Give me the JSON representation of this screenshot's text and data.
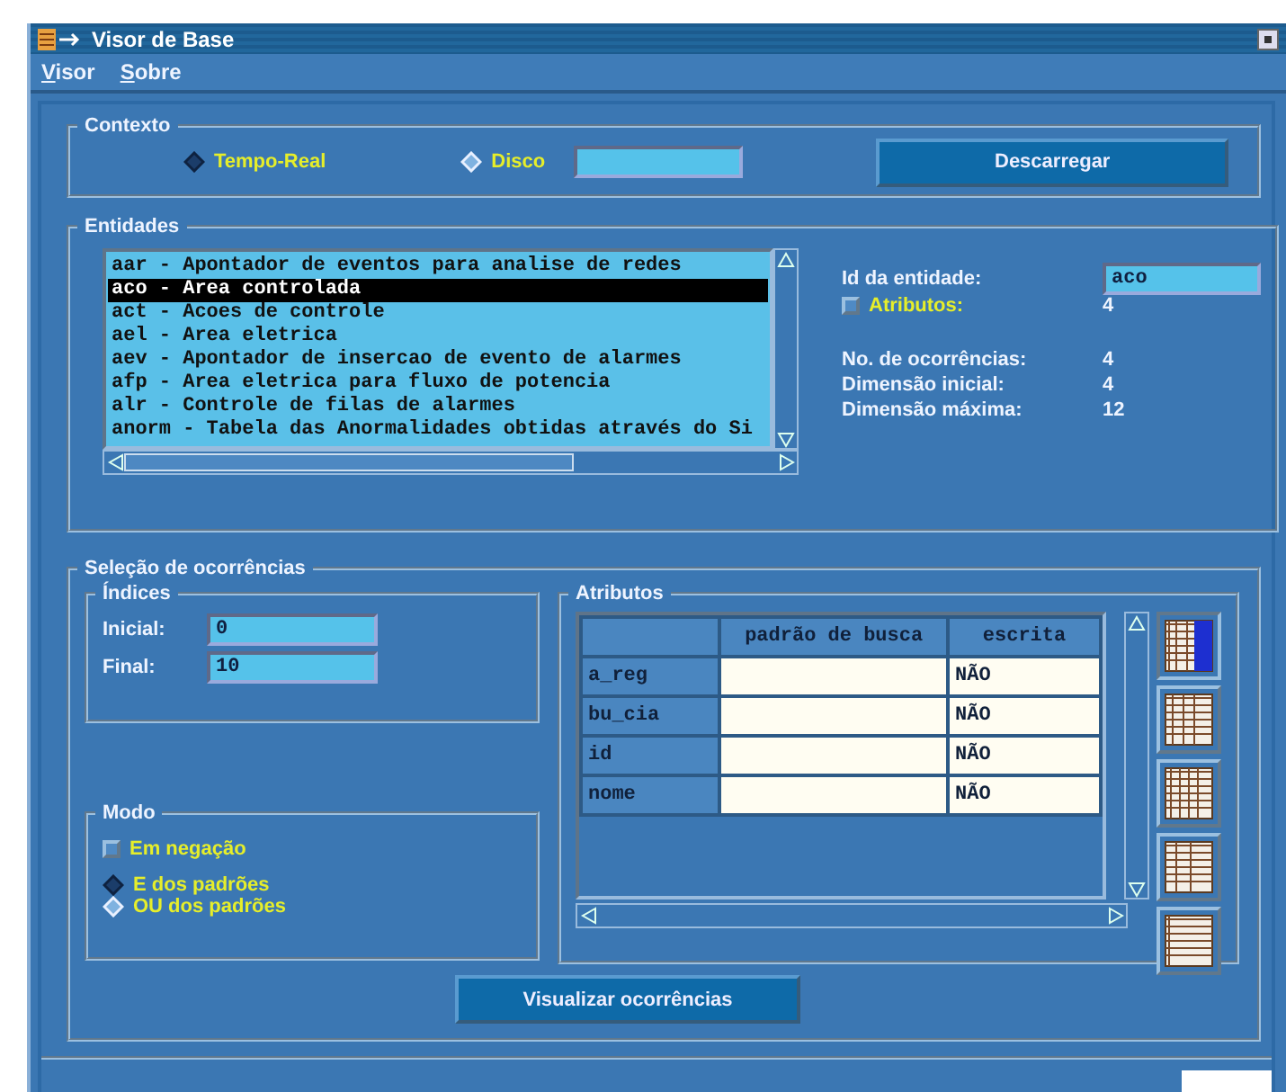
{
  "window": {
    "title": "Visor de Base"
  },
  "menu": [
    "Visor",
    "Sobre"
  ],
  "contexto": {
    "title": "Contexto",
    "options": [
      {
        "label": "Tempo-Real",
        "selected": true
      },
      {
        "label": "Disco",
        "selected": false
      }
    ],
    "button": "Descarregar"
  },
  "entidades": {
    "title": "Entidades",
    "items": [
      {
        "text": "aar - Apontador de eventos para analise de redes",
        "selected": false
      },
      {
        "text": "aco - Area controlada",
        "selected": true
      },
      {
        "text": "act - Acoes de controle",
        "selected": false
      },
      {
        "text": "ael - Area eletrica",
        "selected": false
      },
      {
        "text": "aev - Apontador de insercao de evento de alarmes",
        "selected": false
      },
      {
        "text": "afp - Area eletrica para fluxo de potencia",
        "selected": false
      },
      {
        "text": "alr - Controle de filas de alarmes",
        "selected": false
      },
      {
        "text": "anorm - Tabela das Anormalidades obtidas através do Si",
        "selected": false
      }
    ],
    "id_label": "Id da entidade:",
    "id_value": "aco",
    "atributos": {
      "label": "Atributos:",
      "checked": false,
      "value": "4"
    },
    "stats": [
      {
        "label": "No. de ocorrências:",
        "value": "4"
      },
      {
        "label": "Dimensão inicial:",
        "value": "4"
      },
      {
        "label": "Dimensão máxima:",
        "value": "12"
      }
    ]
  },
  "selecao": {
    "title": "Seleção de ocorrências",
    "indices": {
      "title": "Índices",
      "fields": [
        {
          "label": "Inicial:",
          "value": "0"
        },
        {
          "label": "Final:",
          "value": "10"
        }
      ]
    },
    "modo": {
      "title": "Modo",
      "negacao": {
        "label": "Em negação",
        "checked": false
      },
      "options": [
        {
          "label": "E dos padrões",
          "selected": true
        },
        {
          "label": "OU dos padrões",
          "selected": false
        }
      ]
    },
    "atributos": {
      "title": "Atributos",
      "columns": [
        "padrão de busca",
        "escrita"
      ],
      "rows": [
        {
          "name": "a_reg",
          "escrita": "NÃO"
        },
        {
          "name": "bu_cia",
          "escrita": "NÃO"
        },
        {
          "name": "id",
          "escrita": "NÃO"
        },
        {
          "name": "nome",
          "escrita": "NÃO"
        }
      ],
      "layouts": [
        {
          "selected": true
        },
        {
          "selected": false
        },
        {
          "selected": false
        },
        {
          "selected": false
        },
        {
          "selected": false
        }
      ]
    },
    "button": "Visualizar ocorrências"
  }
}
